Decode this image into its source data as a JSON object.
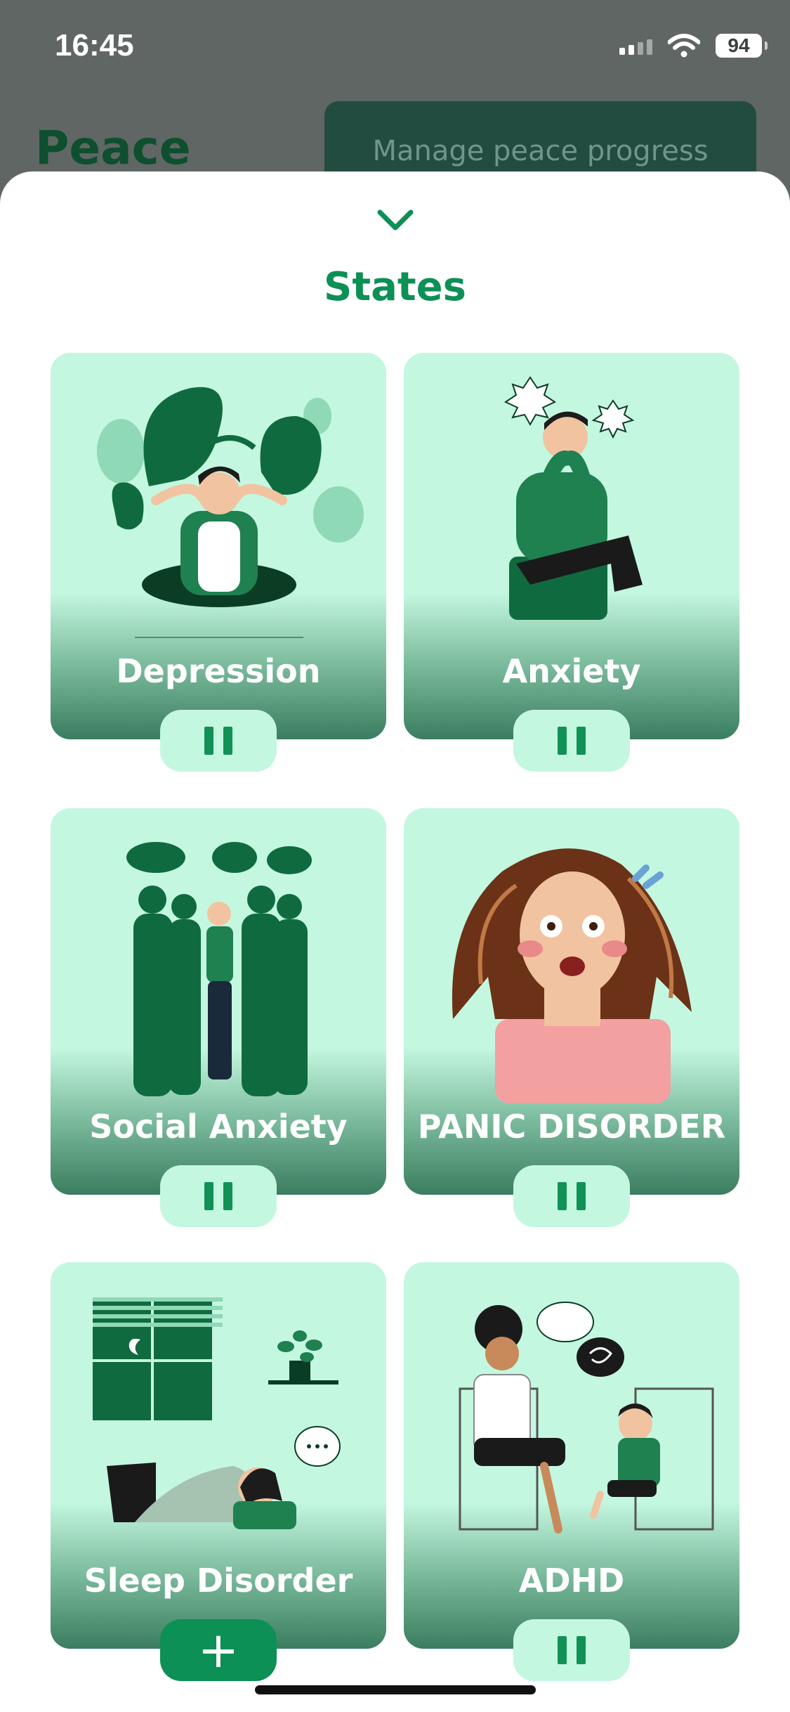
{
  "status": {
    "time": "16:45",
    "battery": "94"
  },
  "page": {
    "title": "Peace",
    "manage_button": "Manage peace progress"
  },
  "sheet": {
    "title": "States",
    "cards": [
      {
        "label": "Depression",
        "action": "pause"
      },
      {
        "label": "Anxiety",
        "action": "pause"
      },
      {
        "label": "Social Anxiety",
        "action": "pause"
      },
      {
        "label": "PANIC DISORDER",
        "action": "pause"
      },
      {
        "label": "Sleep Disorder",
        "action": "add"
      },
      {
        "label": "ADHD",
        "action": "pause"
      }
    ]
  },
  "icons": {
    "collapse": "chevron-down-icon",
    "pause": "pause-icon",
    "add": "plus-icon",
    "signal": "cellular-signal-icon",
    "wifi": "wifi-icon",
    "battery": "battery-icon"
  },
  "colors": {
    "accent": "#0c9055",
    "card_light": "#c4f7e0",
    "card_dark": "#3b7d60",
    "illustration_green": "#0f6b3f"
  }
}
